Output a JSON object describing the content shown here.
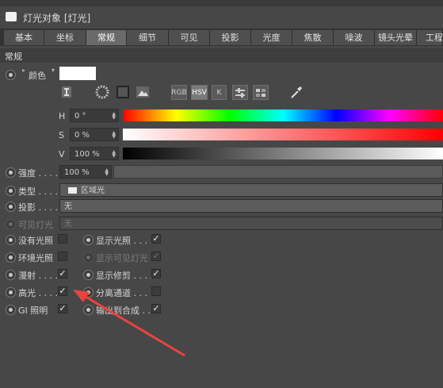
{
  "window": {
    "title": "灯光对象 [灯光]"
  },
  "tabs": [
    {
      "label": "基本"
    },
    {
      "label": "坐标"
    },
    {
      "label": "常规",
      "active": true
    },
    {
      "label": "细节"
    },
    {
      "label": "可见"
    },
    {
      "label": "投影"
    },
    {
      "label": "光度"
    },
    {
      "label": "焦散"
    },
    {
      "label": "噪波"
    },
    {
      "label": "镜头光晕"
    },
    {
      "label": "工程"
    }
  ],
  "section": {
    "title": "常规"
  },
  "color": {
    "label": "颜色",
    "swatch": "#ffffff",
    "modes": {
      "rgb": "RGB",
      "hsv": "HSV",
      "k": "K"
    },
    "h": {
      "label": "H",
      "value": "0 °"
    },
    "s": {
      "label": "S",
      "value": "0 %"
    },
    "v": {
      "label": "V",
      "value": "100 %"
    }
  },
  "intensity": {
    "label": "强度 . . . .",
    "value": "100 %"
  },
  "type": {
    "label": "类型 . . . .",
    "value": "区域光"
  },
  "shadow": {
    "label": "投影 . . . .",
    "value": "无"
  },
  "visible_light": {
    "label": "可见灯光",
    "value": "无"
  },
  "checks_left": [
    {
      "label": "没有光照",
      "checked": false
    },
    {
      "label": "环境光照",
      "checked": false
    },
    {
      "label": "漫射 . . . .",
      "checked": true
    },
    {
      "label": "高光 . . . .",
      "checked": true
    },
    {
      "label": "GI 照明",
      "checked": true
    }
  ],
  "checks_right": [
    {
      "label": "显示光照 . . . .",
      "checked": true
    },
    {
      "label": "显示可见灯光",
      "checked": true
    },
    {
      "label": "显示修剪 . . . .",
      "checked": true
    },
    {
      "label": "分离通道 . . .",
      "checked": false
    },
    {
      "label": "输出到合成 . .",
      "checked": true
    }
  ],
  "annotation": {
    "arrow_color": "#e8453c"
  }
}
